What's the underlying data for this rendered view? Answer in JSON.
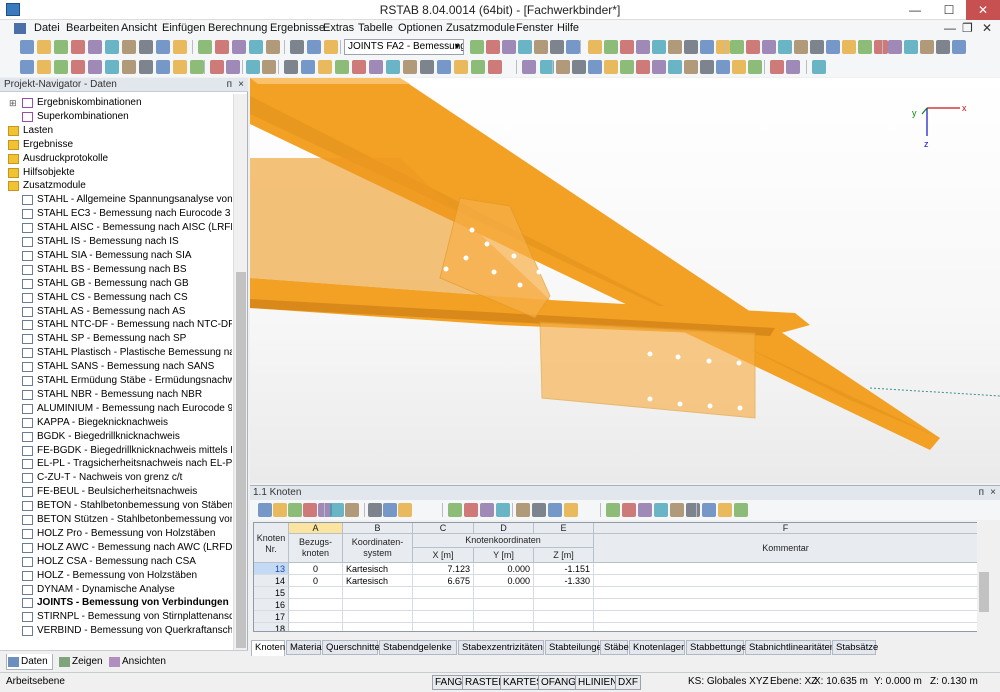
{
  "window": {
    "title": "RSTAB 8.04.0014 (64bit) - [Fachwerkbinder*]",
    "minimize": "—",
    "maximize": "☐",
    "close": "✕"
  },
  "menu": [
    "Datei",
    "Bearbeiten",
    "Ansicht",
    "Einfügen",
    "Berechnung",
    "Ergebnisse",
    "Extras",
    "Tabelle",
    "Optionen",
    "Zusatzmodule",
    "Fenster",
    "Hilfe"
  ],
  "menu_right": [
    "—",
    "❐",
    "✕"
  ],
  "toolbar": {
    "combo": "JOINTS FA2 - Bemessung v"
  },
  "navigator": {
    "title": "Projekt-Navigator - Daten",
    "pin": "ᴨ",
    "close": "×",
    "items": [
      {
        "label": "Ergebniskombinationen",
        "indent": 1,
        "icon": "combo"
      },
      {
        "label": "Superkombinationen",
        "indent": 1,
        "icon": "combo"
      },
      {
        "label": "Lasten",
        "indent": 0,
        "icon": "folder"
      },
      {
        "label": "Ergebnisse",
        "indent": 0,
        "icon": "folder"
      },
      {
        "label": "Ausdruckprotokolle",
        "indent": 0,
        "icon": "folder"
      },
      {
        "label": "Hilfsobjekte",
        "indent": 0,
        "icon": "folder"
      },
      {
        "label": "Zusatzmodule",
        "indent": 0,
        "icon": "folder"
      },
      {
        "label": "STAHL - Allgemeine Spannungsanalyse von Stäben",
        "indent": 2,
        "icon": "module"
      },
      {
        "label": "STAHL EC3 - Bemessung nach Eurocode 3",
        "indent": 2,
        "icon": "module"
      },
      {
        "label": "STAHL AISC - Bemessung nach AISC (LRFD oder ASD)",
        "indent": 2,
        "icon": "module"
      },
      {
        "label": "STAHL IS - Bemessung nach IS",
        "indent": 2,
        "icon": "module"
      },
      {
        "label": "STAHL SIA - Bemessung nach SIA",
        "indent": 2,
        "icon": "module"
      },
      {
        "label": "STAHL BS - Bemessung nach BS",
        "indent": 2,
        "icon": "module"
      },
      {
        "label": "STAHL GB - Bemessung nach GB",
        "indent": 2,
        "icon": "module"
      },
      {
        "label": "STAHL CS - Bemessung nach CS",
        "indent": 2,
        "icon": "module"
      },
      {
        "label": "STAHL AS - Bemessung nach AS",
        "indent": 2,
        "icon": "module"
      },
      {
        "label": "STAHL NTC-DF - Bemessung nach NTC-DF",
        "indent": 2,
        "icon": "module"
      },
      {
        "label": "STAHL SP - Bemessung nach SP",
        "indent": 2,
        "icon": "module"
      },
      {
        "label": "STAHL Plastisch - Plastische Bemessung nach Teilschnittgrößenverfahren",
        "indent": 2,
        "icon": "module"
      },
      {
        "label": "STAHL SANS - Bemessung nach SANS",
        "indent": 2,
        "icon": "module"
      },
      {
        "label": "STAHL Ermüdung Stäbe - Ermüdungsnachweis",
        "indent": 2,
        "icon": "module"
      },
      {
        "label": "STAHL NBR - Bemessung nach NBR",
        "indent": 2,
        "icon": "module"
      },
      {
        "label": "ALUMINIUM - Bemessung nach Eurocode 9",
        "indent": 2,
        "icon": "module"
      },
      {
        "label": "KAPPA - Biegeknicknachweis",
        "indent": 2,
        "icon": "module"
      },
      {
        "label": "BGDK - Biegedrillknicknachweis",
        "indent": 2,
        "icon": "module"
      },
      {
        "label": "FE-BGDK - Biegedrillknicknachweis mittels FEM",
        "indent": 2,
        "icon": "module"
      },
      {
        "label": "EL-PL - Tragsicherheitsnachweis nach EL-PL",
        "indent": 2,
        "icon": "module"
      },
      {
        "label": "C-ZU-T - Nachweis von grenz c/t",
        "indent": 2,
        "icon": "module"
      },
      {
        "label": "FE-BEUL - Beulsicherheitsnachweis",
        "indent": 2,
        "icon": "module"
      },
      {
        "label": "BETON - Stahlbetonbemessung von Stäben",
        "indent": 2,
        "icon": "module"
      },
      {
        "label": "BETON Stützen - Stahlbetonbemessung von Stützen",
        "indent": 2,
        "icon": "module"
      },
      {
        "label": "HOLZ Pro - Bemessung von Holzstäben",
        "indent": 2,
        "icon": "module"
      },
      {
        "label": "HOLZ AWC - Bemessung nach AWC (LRFD oder ASD)",
        "indent": 2,
        "icon": "module"
      },
      {
        "label": "HOLZ CSA - Bemessung nach CSA",
        "indent": 2,
        "icon": "module"
      },
      {
        "label": "HOLZ - Bemessung von Holzstäben",
        "indent": 2,
        "icon": "module"
      },
      {
        "label": "DYNAM - Dynamische Analyse",
        "indent": 2,
        "icon": "module"
      },
      {
        "label": "JOINTS - Bemessung von Verbindungen",
        "indent": 2,
        "icon": "module",
        "bold": true
      },
      {
        "label": "STIRNPL - Bemessung von Stirnplattenanschlüssen",
        "indent": 2,
        "icon": "module"
      },
      {
        "label": "VERBIND - Bemessung von Querkraftanschlüssen",
        "indent": 2,
        "icon": "module"
      }
    ],
    "tabs": [
      "Daten",
      "Zeigen",
      "Ansichten"
    ]
  },
  "axes": {
    "x": "x",
    "y": "y",
    "z": "z"
  },
  "table": {
    "title": "1.1 Knoten",
    "col_letters": [
      "A",
      "B",
      "C",
      "D",
      "E",
      "F"
    ],
    "headers": {
      "rownum": [
        "Knoten",
        "Nr."
      ],
      "bezug": [
        "Bezugs-",
        "knoten"
      ],
      "koord": [
        "Koordinaten-",
        "system"
      ],
      "group": "Knotenkoordinaten",
      "x": "X [m]",
      "y": "Y [m]",
      "z": "Z [m]",
      "kommentar": "Kommentar"
    },
    "rows": [
      {
        "nr": "13",
        "bezug": "0",
        "system": "Kartesisch",
        "x": "7.123",
        "y": "0.000",
        "z": "-1.151",
        "kommentar": ""
      },
      {
        "nr": "14",
        "bezug": "0",
        "system": "Kartesisch",
        "x": "6.675",
        "y": "0.000",
        "z": "-1.330",
        "kommentar": ""
      },
      {
        "nr": "15",
        "bezug": "",
        "system": "",
        "x": "",
        "y": "",
        "z": "",
        "kommentar": ""
      },
      {
        "nr": "16",
        "bezug": "",
        "system": "",
        "x": "",
        "y": "",
        "z": "",
        "kommentar": ""
      },
      {
        "nr": "17",
        "bezug": "",
        "system": "",
        "x": "",
        "y": "",
        "z": "",
        "kommentar": ""
      },
      {
        "nr": "18",
        "bezug": "",
        "system": "",
        "x": "",
        "y": "",
        "z": "",
        "kommentar": ""
      }
    ],
    "tabs": [
      "Knoten",
      "Material",
      "Querschnitte",
      "Stabendgelenke",
      "Stabexzentrizitäten",
      "Stabteilungen",
      "Stäbe",
      "Knotenlager",
      "Stabbettungen",
      "Stabnichtlinearitäten",
      "Stabsätze"
    ]
  },
  "statusbar": {
    "left": "Arbeitsebene",
    "toggles": [
      "FANG",
      "RASTER",
      "KARTES",
      "OFANG",
      "HLINIEN",
      "DXF"
    ],
    "ks": "KS: Globales XYZ",
    "ebene": "Ebene: XZ",
    "x": "X:  10.635 m",
    "y": "Y:  0.000 m",
    "z": "Z:  0.130 m"
  },
  "colors": {
    "beam": "#f2a124",
    "beam_dark": "#d9861a",
    "plate": "#f8b04a",
    "accent_select": "#fbe3a0"
  }
}
